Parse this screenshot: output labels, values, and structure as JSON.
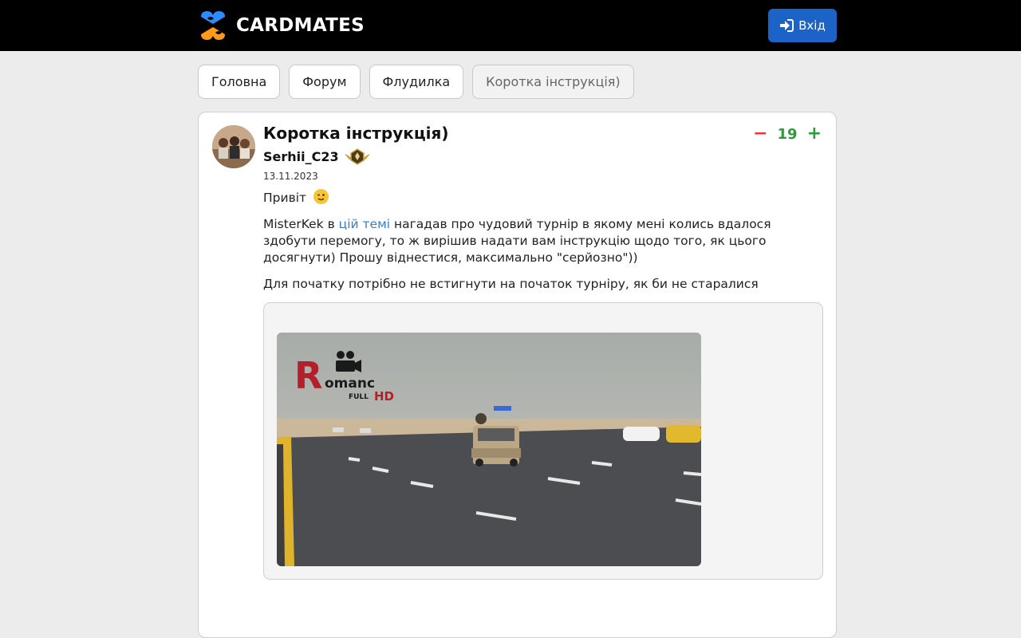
{
  "header": {
    "brand": "CARDMATES",
    "login_label": "Вхід"
  },
  "tabs": [
    {
      "label": "Головна"
    },
    {
      "label": "Форум"
    },
    {
      "label": "Флудилка"
    },
    {
      "label": "Коротка інструкція)"
    }
  ],
  "post": {
    "title": "Коротка інструкція)",
    "author": "Serhii_C23",
    "date": "13.11.2023",
    "votes": {
      "down": "−",
      "count": "19",
      "up": "+"
    },
    "greeting": "Привіт",
    "para1_start": "MisterKek в ",
    "para1_link": "цій темі",
    "para1_end": " нагадав про чудовий турнір в якому мені колись вдалося здобути перемогу, то ж вирішив надати вам інструкцію щодо того, як цього досягнути) Прошу віднестися, максимально \"серйозно\"))",
    "para2": "Для початку потрібно не встигнути на початок турніру, як би не старалися"
  },
  "media": {
    "watermark_letter": "R",
    "watermark_rest": "omanc",
    "watermark_full": "FULL",
    "watermark_hd": "HD"
  },
  "colors": {
    "topbar": "#000000",
    "login_button": "#1b63c6",
    "vote_down": "#e53935",
    "vote_up": "#2e9a3c",
    "link": "#2f7fd3"
  }
}
